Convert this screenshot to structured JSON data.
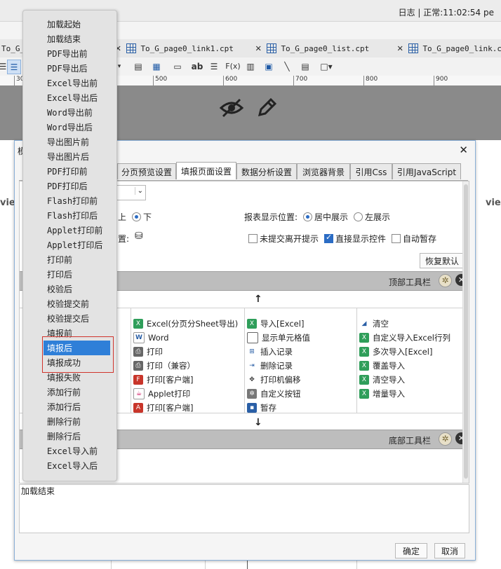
{
  "status_bar": {
    "text": "日志 | 正常:11:02:54 pe"
  },
  "tabs": [
    {
      "label": "To_G_"
    },
    {
      "label": "To_G_page0_link1.cpt"
    },
    {
      "label": "To_G_page0_list.cpt"
    },
    {
      "label": "To_G_page0_link.cp"
    }
  ],
  "ruler": [
    "300",
    "500",
    "600",
    "700",
    "800",
    "900"
  ],
  "toolbar_items": [
    "ab",
    "F(x)"
  ],
  "sheet_side_labels": {
    "left": "vie",
    "right": "vie"
  },
  "dialog": {
    "title_partial": "模",
    "tabs": [
      "分页预览设置",
      "填报页面设置",
      "数据分析设置",
      "浏览器背景",
      "引用Css",
      "引用JavaScript"
    ],
    "active_tab": "填报页面设置",
    "row1": {
      "select_suffix": "置",
      "radio_top": "上",
      "radio_down": "下",
      "display_pos_label": "报表显示位置:",
      "center_label": "居中展示",
      "left_label": "左展示"
    },
    "row2": {
      "bg_label": "置:",
      "checkbox_unsubmitted": "未提交离开提示",
      "checkbox_direct": "直接显示控件",
      "checkbox_autosave": "自动暂存"
    },
    "restore_default": "恢复默认",
    "top_toolbar_label": "顶部工具栏",
    "bottom_toolbar_label": "底部工具栏",
    "button_grid": [
      [
        "Excel(分页分Sheet导出)",
        "导入[Excel]",
        "清空"
      ],
      [
        "Word",
        "显示单元格值",
        "自定义导入Excel行列"
      ],
      [
        "打印",
        "插入记录",
        "多次导入[Excel]"
      ],
      [
        "打印（兼容）",
        "删除记录",
        "覆盖导入"
      ],
      [
        "打印[客户端]",
        "打印机偏移",
        "清空导入"
      ],
      [
        "Applet打印",
        "自定义按钮",
        "增量导入"
      ],
      [
        "打印[客户端]",
        "暂存",
        ""
      ]
    ],
    "event_text": "加载结束",
    "ok_button": "确定",
    "cancel_button": "取消"
  },
  "context_menu": {
    "items": [
      "加载起始",
      "加载结束",
      "PDF导出前",
      "PDF导出后",
      "Excel导出前",
      "Excel导出后",
      "Word导出前",
      "Word导出后",
      "导出图片前",
      "导出图片后",
      "PDF打印前",
      "PDF打印后",
      "Flash打印前",
      "Flash打印后",
      "Applet打印前",
      "Applet打印后",
      "打印前",
      "打印后",
      "校验后",
      "校验提交前",
      "校验提交后",
      "填报前",
      "填报后",
      "填报成功",
      "填报失败",
      "添加行前",
      "添加行后",
      "删除行前",
      "删除行后",
      "Excel导入前",
      "Excel导入后"
    ],
    "selected_item": "填报后",
    "highlighted_items": [
      "填报后",
      "填报成功"
    ]
  },
  "colors": {
    "accent": "#2f7fd8",
    "highlight_border": "#d0342c",
    "canvas": "#8a8a8a"
  }
}
